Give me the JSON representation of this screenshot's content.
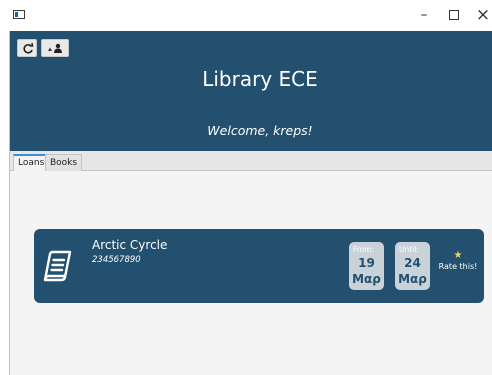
{
  "window": {
    "controls": {
      "minimize": "–",
      "close": "×"
    }
  },
  "header": {
    "title": "Library ECE",
    "welcome": "Welcome, kreps!"
  },
  "tabs": [
    {
      "label": "Loans"
    },
    {
      "label": "Books"
    }
  ],
  "loans": [
    {
      "title": "Arctic Cyrcle",
      "isbn": "234567890",
      "from": {
        "label": "From:",
        "day": "19",
        "month": "Μαρ"
      },
      "until": {
        "label": "Until:",
        "day": "24",
        "month": "Μαρ"
      },
      "rating": {
        "star": "★",
        "label": "Rate this!"
      }
    }
  ],
  "colors": {
    "header": "#23506f",
    "card": "#23506f",
    "date_box": "#c9d2d8",
    "star": "#f0d060",
    "tab_accent": "#3c8fd0"
  },
  "icons": {
    "refresh": "refresh-icon",
    "user": "user-icon",
    "book": "book-icon",
    "star": "star-icon"
  }
}
